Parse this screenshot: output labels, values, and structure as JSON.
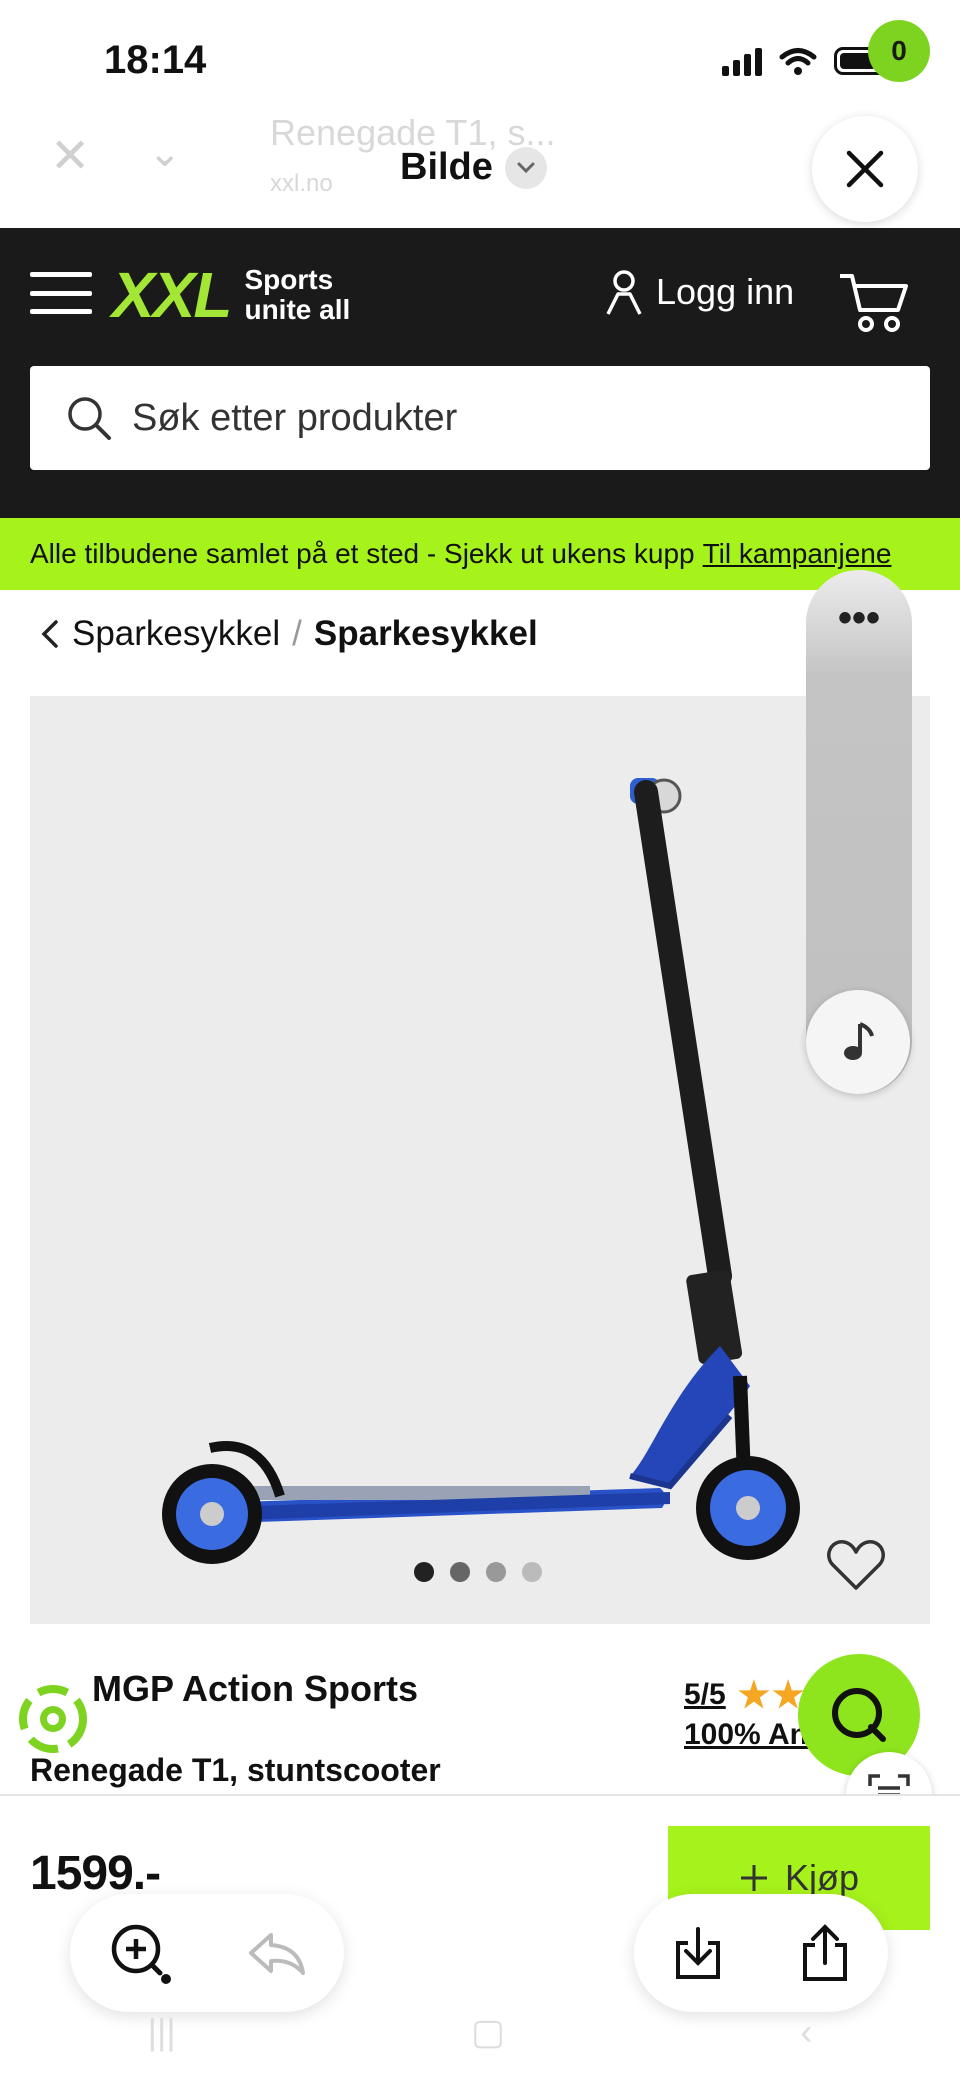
{
  "status_bar": {
    "time": "18:14"
  },
  "viewer": {
    "background_title": "Renegade T1, s...",
    "background_subtitle": "xxl.no",
    "mode_label": "Bilde"
  },
  "header": {
    "logo_text": "XXL",
    "logo_tagline_1": "Sports",
    "logo_tagline_2": "unite all",
    "login_label": "Logg inn",
    "cart_count": "0",
    "search_placeholder": "Søk etter produkter"
  },
  "promo": {
    "text": "Alle tilbudene samlet på et sted - Sjekk ut ukens kupp",
    "link": "Til kampanjene"
  },
  "breadcrumb": {
    "parent": "Sparkesykkel",
    "separator": "/",
    "current": "Sparkesykkel"
  },
  "carousel": {
    "slides": 4,
    "active": 1
  },
  "side_widget": {
    "more_label": "•••"
  },
  "product": {
    "brand": "MGP Action Sports",
    "name": "Renegade T1, stuntscooter",
    "rating_score": "5/5",
    "rating_stars": 5,
    "recommend": "100% Anbefaler",
    "price": "1599.-",
    "buy_label": "Kjøp"
  },
  "colors": {
    "brand_green": "#a6f21b",
    "header_dark": "#1a1a1a",
    "star": "#f5a623"
  }
}
